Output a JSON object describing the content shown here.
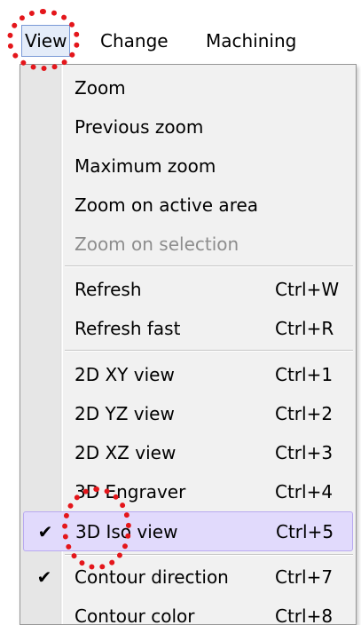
{
  "menubar": {
    "items": [
      {
        "label": "View"
      },
      {
        "label": "Change"
      },
      {
        "label": "Machining"
      }
    ]
  },
  "menu": {
    "items": [
      {
        "label": "Zoom",
        "shortcut": "",
        "checked": false,
        "disabled": false
      },
      {
        "label": "Previous zoom",
        "shortcut": "",
        "checked": false,
        "disabled": false
      },
      {
        "label": "Maximum zoom",
        "shortcut": "",
        "checked": false,
        "disabled": false
      },
      {
        "label": "Zoom on active area",
        "shortcut": "",
        "checked": false,
        "disabled": false
      },
      {
        "label": "Zoom on selection",
        "shortcut": "",
        "checked": false,
        "disabled": true
      },
      {
        "label": "Refresh",
        "shortcut": "Ctrl+W",
        "checked": false,
        "disabled": false
      },
      {
        "label": "Refresh fast",
        "shortcut": "Ctrl+R",
        "checked": false,
        "disabled": false
      },
      {
        "label": "2D XY view",
        "shortcut": "Ctrl+1",
        "checked": false,
        "disabled": false
      },
      {
        "label": "2D YZ view",
        "shortcut": "Ctrl+2",
        "checked": false,
        "disabled": false
      },
      {
        "label": "2D XZ view",
        "shortcut": "Ctrl+3",
        "checked": false,
        "disabled": false
      },
      {
        "label": "3D Engraver",
        "shortcut": "Ctrl+4",
        "checked": false,
        "disabled": false
      },
      {
        "label": "3D Iso view",
        "shortcut": "Ctrl+5",
        "checked": true,
        "disabled": false
      },
      {
        "label": "Contour direction",
        "shortcut": "Ctrl+7",
        "checked": true,
        "disabled": false
      },
      {
        "label": "Contour color",
        "shortcut": "Ctrl+8",
        "checked": false,
        "disabled": false
      }
    ],
    "check_glyph": "✔"
  },
  "colors": {
    "highlight": "#e1dafc",
    "annotation": "#e4161b",
    "disabled_text": "#8d8d8d"
  }
}
